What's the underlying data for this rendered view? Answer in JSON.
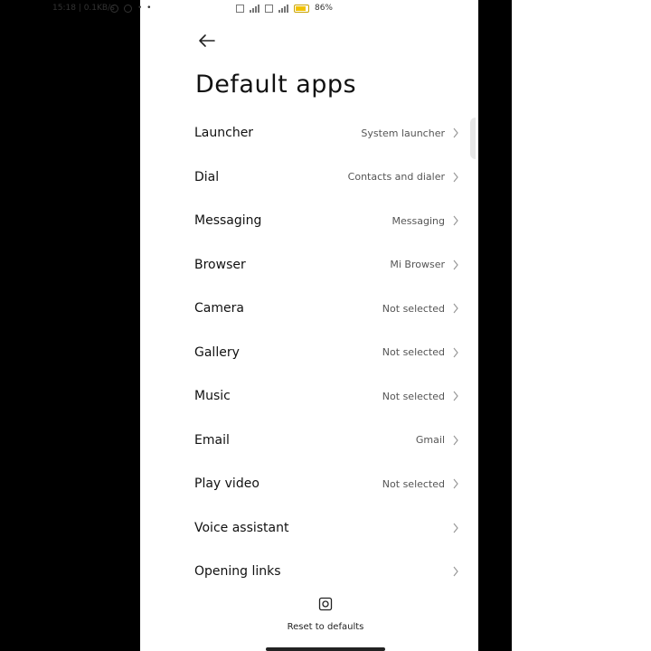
{
  "status_bar": {
    "time_speed": "15:18 | 0.1KB/s",
    "dots": "• •",
    "battery_percent": "86%",
    "battery_level": 0.86
  },
  "page": {
    "title": "Default apps"
  },
  "items": [
    {
      "label": "Launcher",
      "value": "System launcher"
    },
    {
      "label": "Dial",
      "value": "Contacts and dialer"
    },
    {
      "label": "Messaging",
      "value": "Messaging"
    },
    {
      "label": "Browser",
      "value": "Mi Browser"
    },
    {
      "label": "Camera",
      "value": "Not selected"
    },
    {
      "label": "Gallery",
      "value": "Not selected"
    },
    {
      "label": "Music",
      "value": "Not selected"
    },
    {
      "label": "Email",
      "value": "Gmail"
    },
    {
      "label": "Play video",
      "value": "Not selected"
    },
    {
      "label": "Voice assistant",
      "value": ""
    },
    {
      "label": "Opening links",
      "value": ""
    }
  ],
  "footer": {
    "reset_label": "Reset to defaults"
  },
  "colors": {
    "battery": "#f2c200"
  }
}
